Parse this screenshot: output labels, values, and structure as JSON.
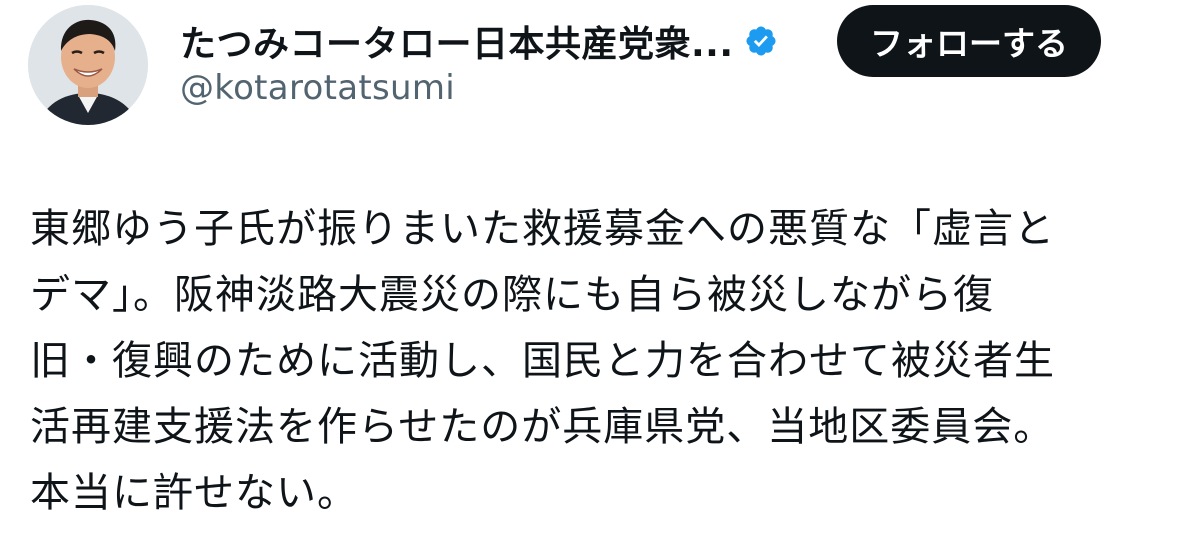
{
  "author": {
    "display_name": "たつみコータロー日本共産党衆...",
    "handle": "@kotarotatsumi",
    "verified": true,
    "avatar_icon": "profile-photo"
  },
  "follow_button": {
    "label": "フォローする"
  },
  "tweet": {
    "lines": [
      "東郷ゆう子氏が振りまいた救援募金への悪質な「虚言と",
      "デマ」。阪神淡路大震災の際にも自ら被災しながら復",
      "旧・復興のために活動し、国民と力を合わせて被災者生",
      "活再建支援法を作らせたのが兵庫県党、当地区委員会。",
      "本当に許せない。"
    ]
  },
  "colors": {
    "text": "#0f1419",
    "secondary_text": "#536471",
    "verified_badge": "#1d9bf0",
    "button_bg": "#0f1419",
    "button_text": "#ffffff",
    "background": "#ffffff"
  }
}
